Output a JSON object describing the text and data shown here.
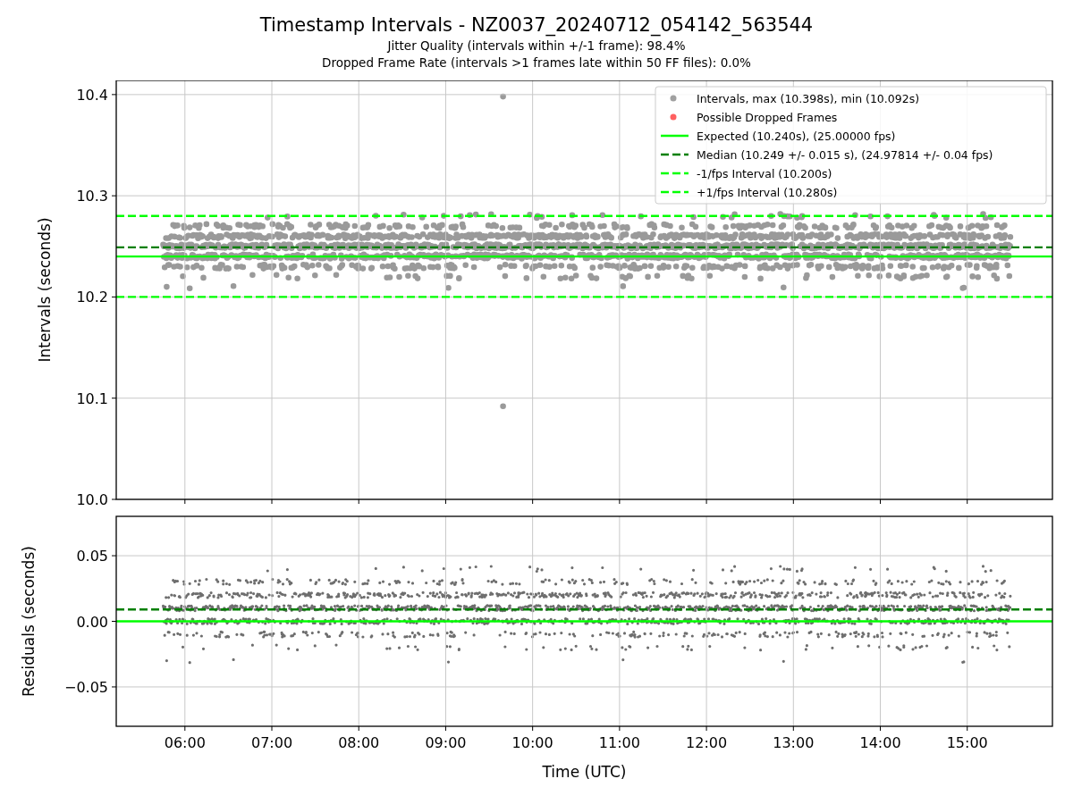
{
  "figure": {
    "title": "Timestamp Intervals - NZ0037_20240712_054142_563544",
    "subtitles": [
      "Jitter Quality (intervals within +/-1 frame): 98.4%",
      "Dropped Frame Rate (intervals >1 frames late within 50 FF files): 0.0%"
    ]
  },
  "intervals_plot": {
    "legend_markers": [
      {
        "label": "Intervals, max (10.398s), min (10.092s)",
        "color": "#a0a0a0"
      },
      {
        "label": "Possible Dropped Frames",
        "color": "#ff6060"
      }
    ],
    "chart_data": {
      "type": "line",
      "ylabel": "Intervals (seconds)",
      "grid": true,
      "legend": true,
      "xlim": [
        5.21,
        15.98
      ],
      "ylim": [
        10.0,
        10.414
      ],
      "yticks": [
        {
          "value": 10.0,
          "label": "10.0"
        },
        {
          "value": 10.1,
          "label": "10.1"
        },
        {
          "value": 10.2,
          "label": "10.2"
        },
        {
          "value": 10.3,
          "label": "10.3"
        },
        {
          "value": 10.4,
          "label": "10.4"
        }
      ],
      "x": [
        5.21,
        15.98
      ],
      "series": [
        {
          "name": "Expected (10.240s), (25.00000 fps)",
          "color": "#00ff00",
          "line_style": "solid",
          "values": [
            10.24,
            10.24
          ]
        },
        {
          "name": "Median (10.249 +/- 0.015 s), (24.97814 +/- 0.04 fps)",
          "color": "#007f00",
          "line_style": "dashed",
          "values": [
            10.249,
            10.249
          ]
        },
        {
          "name": "-1/fps Interval (10.200s)",
          "color": "#00ff00",
          "line_style": "dashed",
          "values": [
            10.2,
            10.2
          ]
        },
        {
          "name": "+1/fps Interval (10.280s)",
          "color": "#00ff00",
          "line_style": "dashed",
          "values": [
            10.28,
            10.28
          ]
        }
      ]
    }
  },
  "residuals_plot": {
    "chart_data": {
      "type": "line",
      "xlabel": "Time (UTC)",
      "ylabel": "Residuals (seconds)",
      "grid": true,
      "xlim": [
        5.21,
        15.98
      ],
      "ylim": [
        -0.08,
        0.08
      ],
      "xticks": [
        {
          "value": 6,
          "label": "06:00"
        },
        {
          "value": 7,
          "label": "07:00"
        },
        {
          "value": 8,
          "label": "08:00"
        },
        {
          "value": 9,
          "label": "09:00"
        },
        {
          "value": 10,
          "label": "10:00"
        },
        {
          "value": 11,
          "label": "11:00"
        },
        {
          "value": 12,
          "label": "12:00"
        },
        {
          "value": 13,
          "label": "13:00"
        },
        {
          "value": 14,
          "label": "14:00"
        },
        {
          "value": 15,
          "label": "15:00"
        }
      ],
      "yticks": [
        {
          "value": -0.05,
          "label": "−0.05"
        },
        {
          "value": 0,
          "label": "0.00"
        },
        {
          "value": 0.05,
          "label": "0.05"
        }
      ],
      "x": [
        5.21,
        15.98
      ],
      "series": [
        {
          "color": "#00ff00",
          "line_style": "solid",
          "values": [
            0,
            0
          ]
        },
        {
          "color": "#007f00",
          "line_style": "dashed",
          "values": [
            0.009,
            0.009
          ]
        }
      ]
    }
  }
}
